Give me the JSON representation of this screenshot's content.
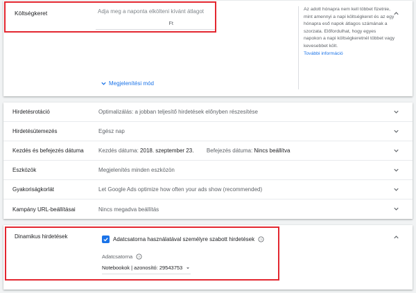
{
  "budget": {
    "label": "Költségkeret",
    "placeholder": "Adja meg a naponta elkölteni kívánt átlagot",
    "currency": "Ft",
    "display_mode": "Megjelenítési mód",
    "help_text": "Az adott hónapra nem kell többet fizetnie, mint amennyi a napi költségkeret és az egy hónapra eső napok átlagos számának a szorzata. Előfordulhat, hogy egyes napokon a napi költségkeretnél többet vagy kevesebbet költ.",
    "help_link": "További információ"
  },
  "settings": {
    "rows": [
      {
        "label": "Hirdetésrotáció",
        "value": "Optimalizálás: a jobban teljesítő hirdetések előnyben részesítése"
      },
      {
        "label": "Hirdetésütemezés",
        "value": "Egész nap"
      },
      {
        "label": "Kezdés és befejezés dátuma",
        "start_prefix": "Kezdés dátuma:",
        "start_value": "2018. szeptember 23.",
        "end_prefix": "Befejezés dátuma:",
        "end_value": "Nincs beállítva"
      },
      {
        "label": "Eszközök",
        "value": "Megjelenítés minden eszközön"
      },
      {
        "label": "Gyakoriságkorlát",
        "value": "Let Google Ads optimize how often your ads show (recommended)"
      },
      {
        "label": "Kampány URL-beállításai",
        "value": "Nincs megadva beállítás"
      }
    ]
  },
  "dynamic": {
    "label": "Dinamikus hirdetések",
    "checkbox_label": "Adatcsatorna használatával személyre szabott hirdetések",
    "checkbox_checked": true,
    "feed_label": "Adatcsatorna",
    "feed_value": "Notebookok | azonosító: 29543753"
  },
  "colors": {
    "accent": "#1a73e8",
    "highlight": "#e3262f"
  }
}
